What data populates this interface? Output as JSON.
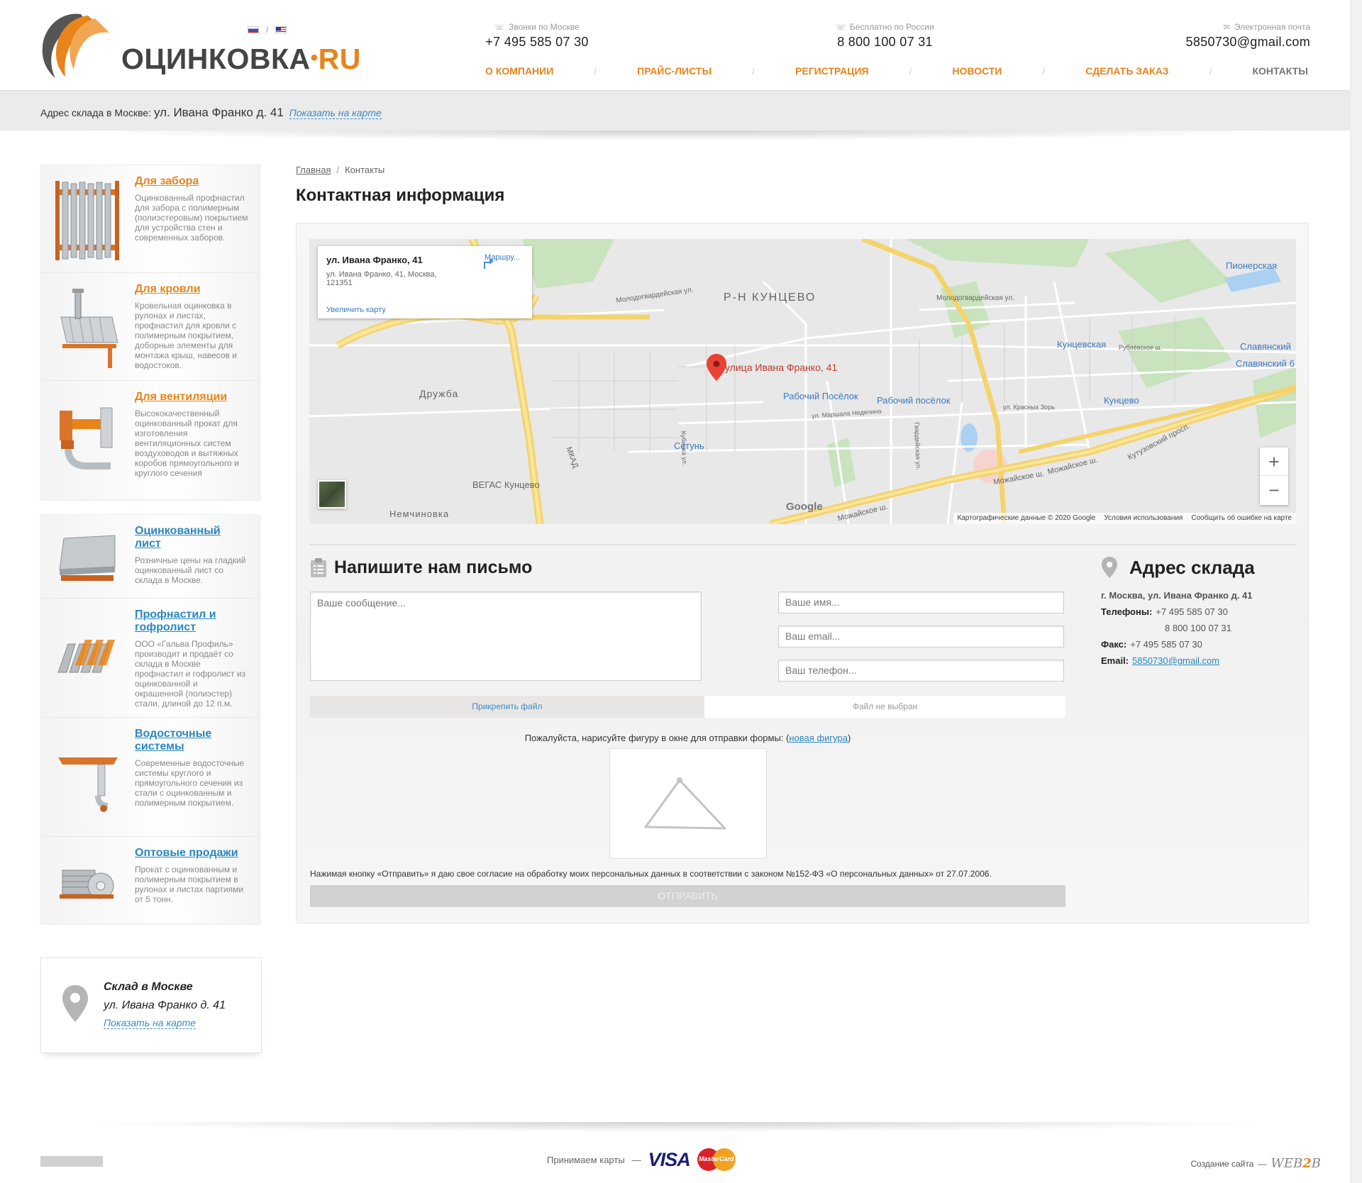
{
  "header": {
    "logo_main": "ОЦИНКОВКА",
    "logo_dot": "•",
    "logo_ru": "RU",
    "lang_sep": "/",
    "phone_moscow_caption": "Звонки по Москве",
    "phone_moscow": "+7 495 585 07 30",
    "phone_free_caption": "Бесплатно по России",
    "phone_free": "8 800 100 07 31",
    "email_caption": "Электронная почта",
    "email": "5850730@gmail.com"
  },
  "nav": {
    "items": [
      {
        "label": "О компании"
      },
      {
        "label": "Прайс-листы"
      },
      {
        "label": "Регистрация"
      },
      {
        "label": "Новости"
      },
      {
        "label": "Сделать заказ"
      },
      {
        "label": "Контакты"
      }
    ],
    "separator": "/"
  },
  "address_bar": {
    "label": "Адрес склада в Москве:",
    "address": "ул. Ивана Франко д. 41",
    "map_link": "Показать на карте"
  },
  "sidebar": {
    "groups": [
      [
        {
          "title": "Для забора",
          "desc": "Оцинкованный профнастил для забора с полимерным (полиэстеровым) покрытием для устройства стен и современных заборов.",
          "icon": "fence-icon",
          "color": "orange"
        },
        {
          "title": "Для кровли",
          "desc": "Кровельная оцинковка в рулонах и листах, профнастил для кровли с полимерным покрытием, доборные элементы для монтажа крыш, навесов и водостоков.",
          "icon": "roof-icon",
          "color": "orange"
        },
        {
          "title": "Для вентиляции",
          "desc": "Высококачественный оцинкованный прокат для изготовления вентиляционных систем воздуховодов и вытяжных коробов прямоугольного и круглого сечения",
          "icon": "ventilation-icon",
          "color": "orange"
        }
      ],
      [
        {
          "title": "Оцинкованный лист",
          "desc": "Розничные цены на гладкий оцинкованный лист со склада в Москве.",
          "icon": "sheet-icon",
          "color": "blue"
        },
        {
          "title": "Профнастил и гофролист",
          "desc": "ООО «Гальва Профиль» производит и продаёт со склада в Москве профнастил и гофролист из оцинкованной и окрашенной (полиэстер) стали, длиной до 12 п.м.",
          "icon": "corrugated-icon",
          "color": "blue"
        },
        {
          "title": "Водосточные системы",
          "desc": "Современные водосточные системы круглого и прямоугольного сечения из стали с оцинкованным и полимерным покрытием.",
          "icon": "gutter-icon",
          "color": "blue"
        },
        {
          "title": "Оптовые продажи",
          "desc": "Прокат с оцинкованным и полимерным покрытием в рулонах и листах партиями от 5 тонн.",
          "icon": "wholesale-icon",
          "color": "blue"
        }
      ]
    ],
    "store": {
      "title": "Склад в Москве",
      "address": "ул. Ивана Франко д. 41",
      "map_link": "Показать на карте"
    }
  },
  "breadcrumb": {
    "home": "Главная",
    "separator": "/",
    "current": "Контакты"
  },
  "page_title": "Контактная информация",
  "map": {
    "card_title": "ул. Ивана Франко, 41",
    "card_address": "ул. Ивана Франко, 41, Москва, 121351",
    "card_zoom_link": "Увеличить карту",
    "card_route": "Маршру...",
    "district": "Р-Н КУНЦЕВО",
    "marker_label": "улица Ивана Франко, 41",
    "labels": {
      "druzhba": "Дружба",
      "nemchinovka": "Немчиновка",
      "vegas": "ВЕГАС Кунцево",
      "setun": "Сетунь",
      "rabochiy1": "Рабочий Посёлок",
      "rabochiy2": "Рабочий посёлок",
      "kuntsevskaya": "Кунцевская",
      "kuntsevo": "Кунцево",
      "pionerskaya": "Пионерская",
      "slavyanskiy": "Славянский",
      "slavyanskiy_b": "Славянский б",
      "mkad": "МКАД",
      "molodog1": "Молодогвардейская ул.",
      "molodog2": "Молодогвардейская ул.",
      "mozhaiskoe1": "Можайское ш.",
      "mozhaiskoe2": "Можайское ш.",
      "mozhaiskoe3": "Можайское ш.",
      "kutuzovsky": "Кутузовский просп.",
      "marshala": "ул. Маршала Неделина",
      "krasnyh": "ул. Красных Зорь",
      "rublevskoe": "Рублёвское ш.",
      "kubinka": "Кубинка ул.",
      "gvardeiskaya": "Гвардейская ул."
    },
    "zoom_in": "+",
    "zoom_out": "−",
    "google": "Google",
    "footer": [
      "Картографические данные © 2020 Google",
      "Условия использования",
      "Сообщить об ошибке на карте"
    ]
  },
  "form": {
    "title": "Напишите нам письмо",
    "message_placeholder": "Ваше сообщение...",
    "name_placeholder": "Ваше имя...",
    "email_placeholder": "Ваш email...",
    "phone_placeholder": "Ваш телефон...",
    "attach_label": "Прикрепить файл",
    "no_file": "Файл не выбран",
    "captcha_prefix": "Пожалуйста, нарисуйте фигуру в окне для отправки формы: (",
    "captcha_link": "новая фигура",
    "captcha_suffix": ")",
    "consent": "Нажимая кнопку «Отправить» я даю свое согласие на обработку моих персональных данных в соответствии с законом №152-ФЗ «О персональных данных» от 27.07.2006.",
    "submit": "Отправить"
  },
  "warehouse": {
    "title": "Адрес склада",
    "address": "г. Москва, ул. Ивана Франко д. 41",
    "phones_label": "Телефоны:",
    "phone1": "+7 495 585 07 30",
    "phone2": "8 800 100 07 31",
    "fax_label": "Факс:",
    "fax": "+7 495 585 07 30",
    "email_label": "Email:",
    "email": "5850730@gmail.com"
  },
  "footer": {
    "cards_label": "Принимаем карты",
    "dash": "—",
    "visa": "VISA",
    "mastercard": "MasterCard",
    "credit_label": "Создание сайта",
    "credit_brand_a": "WEB",
    "credit_brand_b": "2",
    "credit_brand_c": "B"
  },
  "colors": {
    "accent": "#e8841a",
    "link": "#2a87c0",
    "text": "#333333"
  }
}
